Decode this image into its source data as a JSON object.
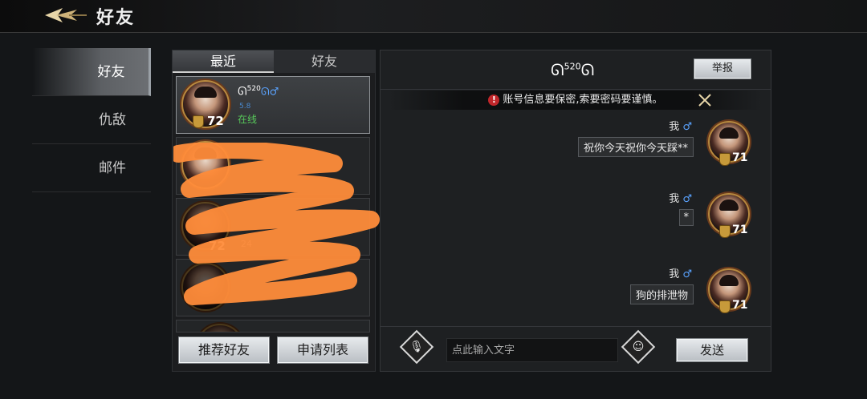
{
  "header": {
    "title": "好友"
  },
  "nav": {
    "items": [
      {
        "label": "好友",
        "active": true
      },
      {
        "label": "仇敌",
        "active": false
      },
      {
        "label": "邮件",
        "active": false
      }
    ]
  },
  "friends_panel": {
    "tabs": [
      {
        "label": "最近",
        "active": true
      },
      {
        "label": "好友",
        "active": false
      }
    ],
    "cards": [
      {
        "name": "ᘏ",
        "name_sup": "520",
        "name_tail": "ᘏ♂",
        "sub": "5.8",
        "status": "在线",
        "level": "72"
      },
      {
        "level": "72",
        "sub": "24"
      }
    ],
    "recommend_button": "推荐好友",
    "request_button": "申请列表"
  },
  "chat": {
    "title_main": "ᘏ",
    "title_sup": "520",
    "title_tail": "ᘏ",
    "report_button": "举报",
    "warning_text": "账号信息要保密,索要密码要谨慎。",
    "messages": [
      {
        "sender": "我",
        "text": "祝你今天祝你今天踩**",
        "level": "71"
      },
      {
        "sender": "我",
        "text": "*",
        "level": "71"
      },
      {
        "sender": "我",
        "text": "狗的排泄物",
        "level": "71"
      }
    ],
    "input_placeholder": "点此输入文字",
    "send_button": "发送"
  },
  "colors": {
    "online": "#57c85a",
    "male": "#5aa3ff",
    "warning": "#c0262a",
    "scribble": "#ff8c3a"
  }
}
